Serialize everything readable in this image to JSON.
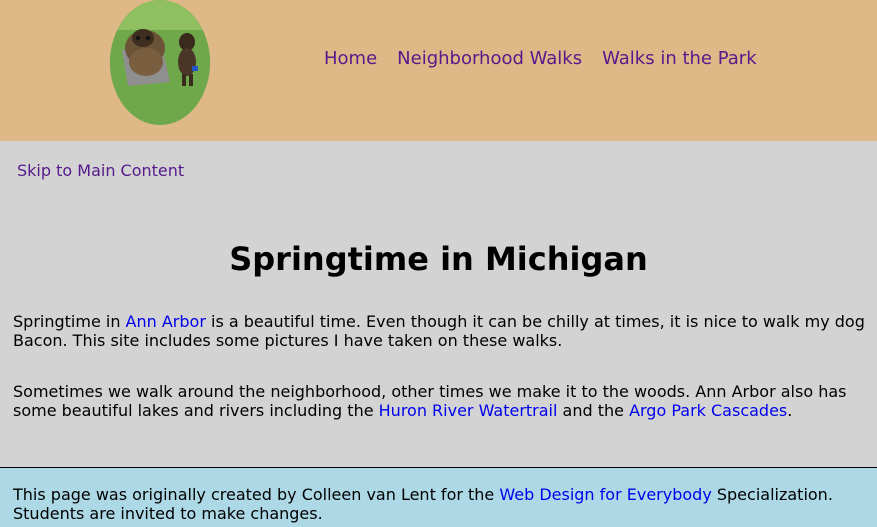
{
  "header": {
    "logo": {
      "alt": "Bacon the dog beside a bison statue"
    },
    "nav": [
      {
        "label": "Home"
      },
      {
        "label": "Neighborhood Walks"
      },
      {
        "label": "Walks in the Park"
      }
    ]
  },
  "skip_link": "Skip to Main Content",
  "main": {
    "title": "Springtime in Michigan",
    "p1": {
      "t1": "Springtime in ",
      "link": "Ann Arbor",
      "t2": " is a beautiful time. Even though it can be chilly at times, it is nice to walk my dog Bacon. This site includes some pictures I have taken on these walks."
    },
    "p2": {
      "t1": "Sometimes we walk around the neighborhood, other times we make it to the woods. Ann Arbor also has some beautiful lakes and rivers including the ",
      "link1": "Huron River Watertrail",
      "t2": " and the ",
      "link2": "Argo Park Cascades",
      "t3": "."
    }
  },
  "footer": {
    "t1": "This page was originally created by Colleen van Lent for the ",
    "link": "Web Design for Everybody",
    "t2": " Specialization. Students are invited to make changes."
  },
  "colors": {
    "header_bg": "#deb887",
    "body_bg": "#d3d3d3",
    "footer_bg": "#add8e6",
    "visited_link": "#551a8b",
    "link": "#0000ee"
  }
}
